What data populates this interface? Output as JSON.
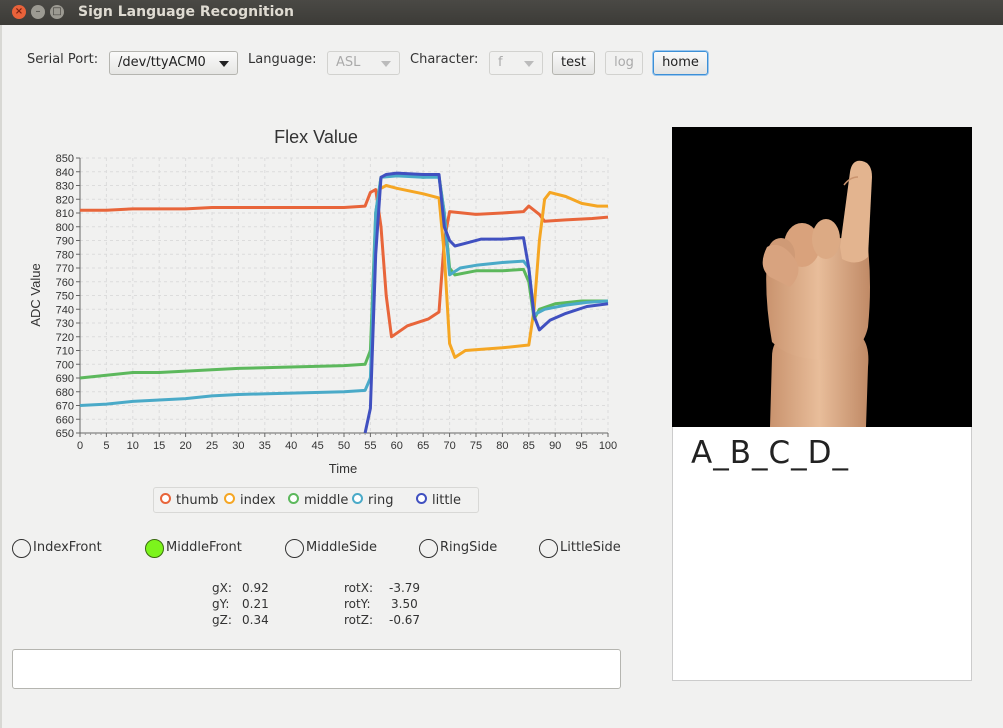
{
  "window": {
    "title": "Sign Language Recognition"
  },
  "toolbar": {
    "serial_label": "Serial Port:",
    "serial_value": "/dev/ttyACM0",
    "language_label": "Language:",
    "language_value": "ASL",
    "character_label": "Character:",
    "character_value": "f",
    "test_label": "test",
    "log_label": "log",
    "home_label": "home"
  },
  "chart_data": {
    "type": "line",
    "title": "Flex Value",
    "xlabel": "Time",
    "ylabel": "ADC Value",
    "xlim": [
      0,
      100
    ],
    "ylim": [
      650,
      850
    ],
    "x_ticks": [
      0,
      5,
      10,
      15,
      20,
      25,
      30,
      35,
      40,
      45,
      50,
      55,
      60,
      65,
      70,
      75,
      80,
      85,
      90,
      95,
      100
    ],
    "y_ticks": [
      650,
      660,
      670,
      680,
      690,
      700,
      710,
      720,
      730,
      740,
      750,
      760,
      770,
      780,
      790,
      800,
      810,
      820,
      830,
      840,
      850
    ],
    "grid": true,
    "legend_position": "bottom",
    "series": [
      {
        "name": "thumb",
        "color": "#e8653a",
        "points": [
          [
            0,
            812
          ],
          [
            5,
            812
          ],
          [
            10,
            813
          ],
          [
            20,
            813
          ],
          [
            25,
            814
          ],
          [
            30,
            814
          ],
          [
            40,
            814
          ],
          [
            50,
            814
          ],
          [
            54,
            815
          ],
          [
            55,
            825
          ],
          [
            56,
            827
          ],
          [
            57,
            800
          ],
          [
            58,
            750
          ],
          [
            59,
            720
          ],
          [
            62,
            728
          ],
          [
            66,
            733
          ],
          [
            68,
            738
          ],
          [
            69,
            790
          ],
          [
            70,
            811
          ],
          [
            75,
            809
          ],
          [
            80,
            810
          ],
          [
            84,
            811
          ],
          [
            85,
            815
          ],
          [
            87,
            809
          ],
          [
            88,
            804
          ],
          [
            92,
            805
          ],
          [
            97,
            806
          ],
          [
            100,
            807
          ]
        ]
      },
      {
        "name": "index",
        "color": "#f5a623",
        "points": [
          [
            57,
            828
          ],
          [
            58,
            830
          ],
          [
            60,
            828
          ],
          [
            65,
            824
          ],
          [
            68,
            821
          ],
          [
            69,
            780
          ],
          [
            70,
            715
          ],
          [
            71,
            705
          ],
          [
            73,
            710
          ],
          [
            80,
            712
          ],
          [
            85,
            714
          ],
          [
            86,
            740
          ],
          [
            87,
            790
          ],
          [
            88,
            820
          ],
          [
            89,
            825
          ],
          [
            92,
            822
          ],
          [
            95,
            817
          ],
          [
            98,
            815
          ],
          [
            100,
            815
          ]
        ]
      },
      {
        "name": "middle",
        "color": "#5cb85c",
        "points": [
          [
            0,
            690
          ],
          [
            5,
            692
          ],
          [
            10,
            694
          ],
          [
            15,
            694
          ],
          [
            20,
            695
          ],
          [
            25,
            696
          ],
          [
            30,
            697
          ],
          [
            40,
            698
          ],
          [
            50,
            699
          ],
          [
            54,
            700
          ],
          [
            55,
            710
          ],
          [
            56,
            810
          ],
          [
            57,
            836
          ],
          [
            60,
            838
          ],
          [
            65,
            836
          ],
          [
            68,
            837
          ],
          [
            69,
            810
          ],
          [
            70,
            770
          ],
          [
            71,
            765
          ],
          [
            75,
            768
          ],
          [
            80,
            768
          ],
          [
            84,
            769
          ],
          [
            85,
            760
          ],
          [
            86,
            733
          ],
          [
            87,
            740
          ],
          [
            90,
            744
          ],
          [
            95,
            746
          ],
          [
            100,
            746
          ]
        ]
      },
      {
        "name": "ring",
        "color": "#4aaac8",
        "points": [
          [
            0,
            670
          ],
          [
            5,
            671
          ],
          [
            10,
            673
          ],
          [
            15,
            674
          ],
          [
            20,
            675
          ],
          [
            25,
            677
          ],
          [
            30,
            678
          ],
          [
            40,
            679
          ],
          [
            50,
            680
          ],
          [
            54,
            681
          ],
          [
            55,
            690
          ],
          [
            56,
            810
          ],
          [
            57,
            836
          ],
          [
            60,
            837
          ],
          [
            65,
            836
          ],
          [
            68,
            836
          ],
          [
            69,
            810
          ],
          [
            70,
            765
          ],
          [
            72,
            770
          ],
          [
            75,
            772
          ],
          [
            80,
            774
          ],
          [
            84,
            775
          ],
          [
            85,
            770
          ],
          [
            86,
            736
          ],
          [
            88,
            740
          ],
          [
            92,
            743
          ],
          [
            96,
            745
          ],
          [
            100,
            746
          ]
        ]
      },
      {
        "name": "little",
        "color": "#4050c0",
        "points": [
          [
            54,
            650
          ],
          [
            55,
            668
          ],
          [
            56,
            780
          ],
          [
            57,
            836
          ],
          [
            58,
            838
          ],
          [
            60,
            839
          ],
          [
            65,
            838
          ],
          [
            68,
            838
          ],
          [
            69,
            800
          ],
          [
            70,
            790
          ],
          [
            71,
            786
          ],
          [
            73,
            788
          ],
          [
            76,
            791
          ],
          [
            80,
            791
          ],
          [
            84,
            792
          ],
          [
            85,
            770
          ],
          [
            86,
            735
          ],
          [
            87,
            725
          ],
          [
            89,
            732
          ],
          [
            92,
            737
          ],
          [
            96,
            742
          ],
          [
            100,
            744
          ]
        ]
      }
    ]
  },
  "sensors": {
    "radios": [
      {
        "label": "IndexFront",
        "checked": false
      },
      {
        "label": "MiddleFront",
        "checked": true
      },
      {
        "label": "MiddleSide",
        "checked": false
      },
      {
        "label": "RingSide",
        "checked": false
      },
      {
        "label": "LittleSide",
        "checked": false
      }
    ],
    "gx": {
      "label": "gX:",
      "value": "0.92"
    },
    "gy": {
      "label": "gY:",
      "value": "0.21"
    },
    "gz": {
      "label": "gZ:",
      "value": "0.34"
    },
    "rotx": {
      "label": "rotX:",
      "value": "-3.79"
    },
    "roty": {
      "label": "rotY:",
      "value": "3.50"
    },
    "rotz": {
      "label": "rotZ:",
      "value": "-0.67"
    }
  },
  "output": {
    "text_value": ""
  },
  "result": {
    "recognized_text": "A_B_C_D_"
  },
  "image": {
    "description_icon": "hand-sign-f-icon"
  }
}
